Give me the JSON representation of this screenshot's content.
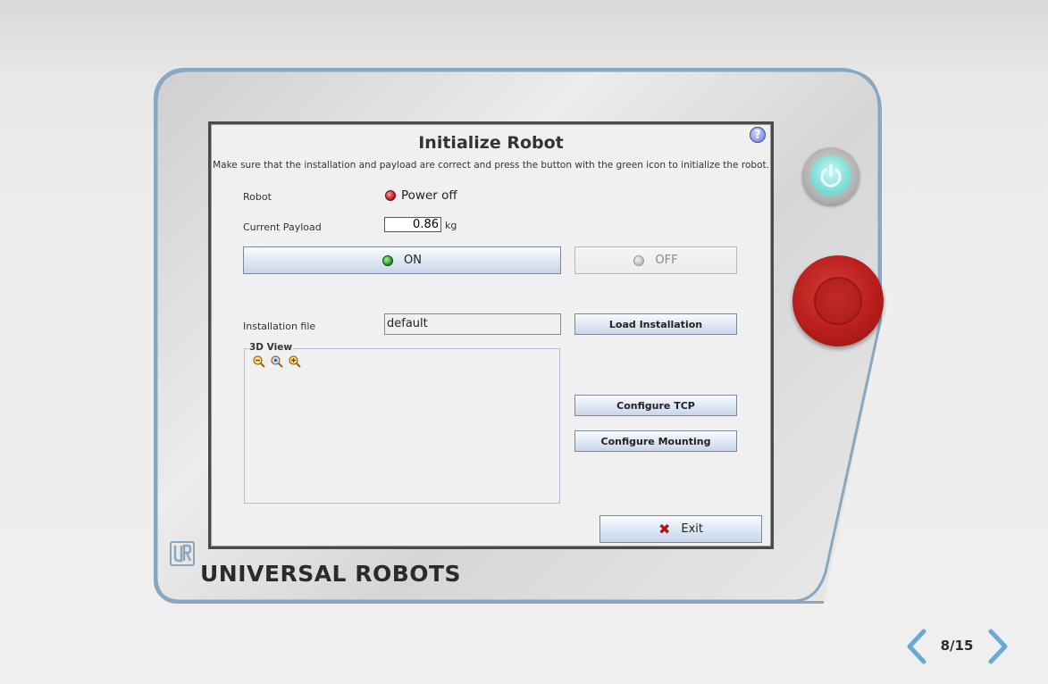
{
  "screen": {
    "title": "Initialize Robot",
    "subtitle": "Make sure that the installation and payload are correct and press the button with the green icon to initialize the robot.",
    "help_icon": "question-mark-icon",
    "robot_label": "Robot",
    "robot_status": "Power off",
    "robot_status_color": "#b01515",
    "payload_label": "Current Payload",
    "payload_value": "0.86",
    "payload_unit": "kg",
    "on_button": {
      "label": "ON",
      "icon": "green-led-icon"
    },
    "off_button": {
      "label": "OFF",
      "icon": "gray-led-icon",
      "disabled": true
    },
    "installation_label": "Installation file",
    "installation_value": "default",
    "load_installation_button": "Load Installation",
    "view_label": "3D View",
    "view_tools": [
      "zoom-out-icon",
      "zoom-reset-icon",
      "zoom-in-icon"
    ],
    "configure_tcp_button": "Configure TCP",
    "configure_mounting_button": "Configure Mounting",
    "exit_button": "Exit"
  },
  "hardware": {
    "brand": "UNIVERSAL ROBOTS",
    "power_button": "power-icon",
    "estop": "emergency-stop-button",
    "power_color": "#8fe3dd",
    "estop_color": "#b81f1c"
  },
  "pagination": {
    "page": "8/15"
  }
}
